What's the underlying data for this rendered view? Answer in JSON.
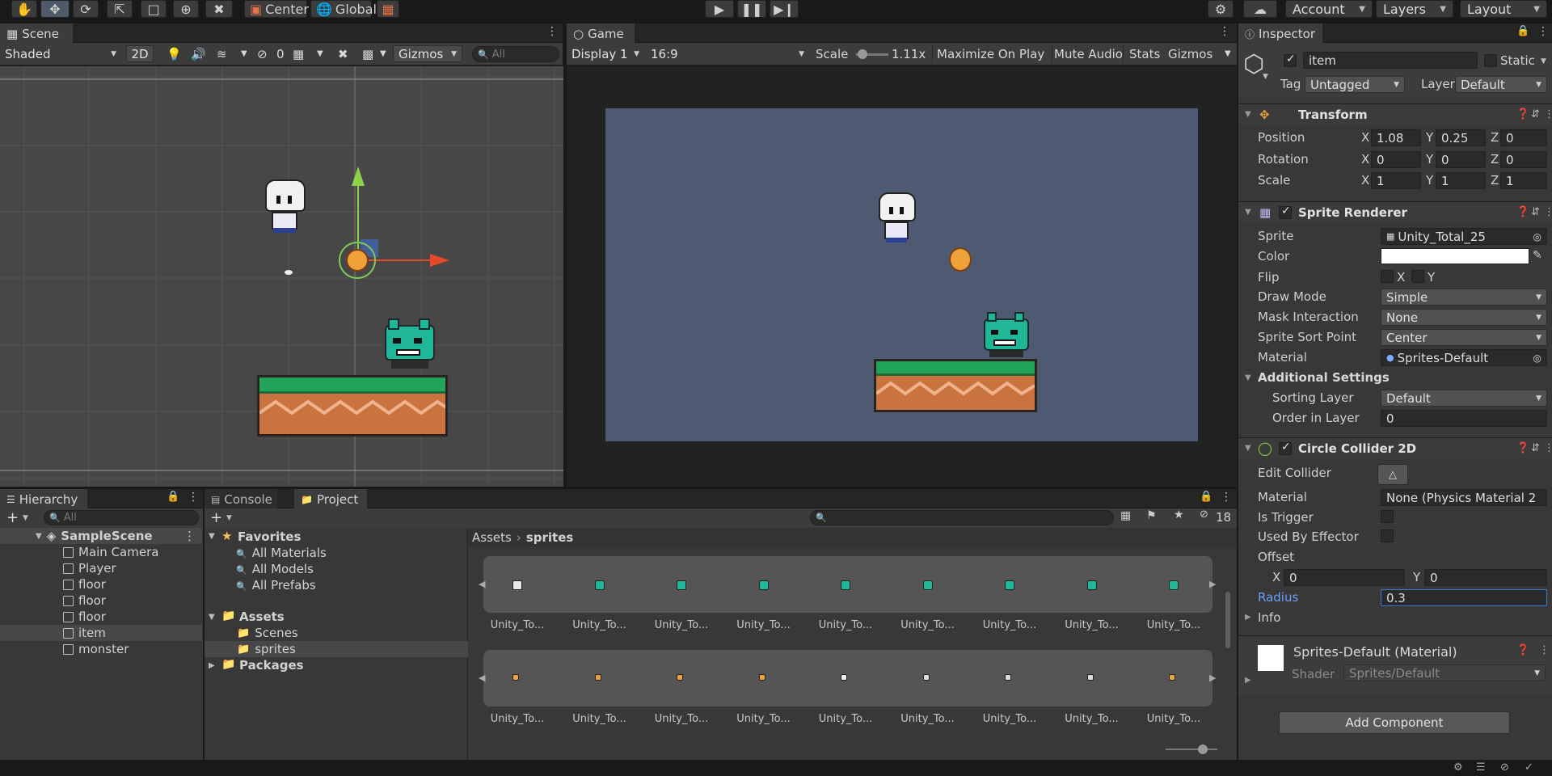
{
  "toolbar": {
    "pivot": "Center",
    "space": "Global",
    "account": "Account",
    "layers": "Layers",
    "layout": "Layout"
  },
  "scene": {
    "tab": "Scene",
    "shading": "Shaded",
    "mode2d": "2D",
    "hidden_count": "0",
    "gizmos": "Gizmos",
    "search_placeholder": "All"
  },
  "game": {
    "tab": "Game",
    "display": "Display 1",
    "aspect": "16:9",
    "scale_label": "Scale",
    "scale_value": "1.11x",
    "maximize": "Maximize On Play",
    "mute": "Mute Audio",
    "stats": "Stats",
    "gizmos": "Gizmos"
  },
  "inspector": {
    "tab": "Inspector",
    "object_name": "item",
    "static_label": "Static",
    "tag_label": "Tag",
    "tag_value": "Untagged",
    "layer_label": "Layer",
    "layer_value": "Default",
    "transform": {
      "title": "Transform",
      "position_label": "Position",
      "rotation_label": "Rotation",
      "scale_label": "Scale",
      "position": {
        "x": "1.08",
        "y": "0.25",
        "z": "0"
      },
      "rotation": {
        "x": "0",
        "y": "0",
        "z": "0"
      },
      "scale": {
        "x": "1",
        "y": "1",
        "z": "1"
      }
    },
    "sprite_renderer": {
      "title": "Sprite Renderer",
      "sprite_label": "Sprite",
      "sprite_value": "Unity_Total_25",
      "color_label": "Color",
      "flip_label": "Flip",
      "flip_x": "X",
      "flip_y": "Y",
      "draw_mode_label": "Draw Mode",
      "draw_mode_value": "Simple",
      "mask_label": "Mask Interaction",
      "mask_value": "None",
      "sort_point_label": "Sprite Sort Point",
      "sort_point_value": "Center",
      "material_label": "Material",
      "material_value": "Sprites-Default",
      "additional_label": "Additional Settings",
      "sorting_layer_label": "Sorting Layer",
      "sorting_layer_value": "Default",
      "order_label": "Order in Layer",
      "order_value": "0"
    },
    "collider": {
      "title": "Circle Collider 2D",
      "edit_label": "Edit Collider",
      "material_label": "Material",
      "material_value": "None (Physics Material 2",
      "trigger_label": "Is Trigger",
      "effector_label": "Used By Effector",
      "offset_label": "Offset",
      "offset_x": "0",
      "offset_y": "0",
      "radius_label": "Radius",
      "radius_value": "0.3",
      "info_label": "Info"
    },
    "material_card": {
      "name": "Sprites-Default (Material)",
      "shader_label": "Shader",
      "shader_value": "Sprites/Default"
    },
    "add_component": "Add Component"
  },
  "hierarchy": {
    "tab": "Hierarchy",
    "search_placeholder": "All",
    "scene_name": "SampleScene",
    "items": [
      "Main Camera",
      "Player",
      "floor",
      "floor",
      "floor",
      "item",
      "monster"
    ]
  },
  "project": {
    "console_tab": "Console",
    "project_tab": "Project",
    "hidden_count": "18",
    "favorites_label": "Favorites",
    "favorites": [
      "All Materials",
      "All Models",
      "All Prefabs"
    ],
    "assets_label": "Assets",
    "asset_folders": [
      "Scenes",
      "sprites"
    ],
    "packages_label": "Packages",
    "breadcrumb_root": "Assets",
    "breadcrumb_current": "sprites",
    "asset_names": [
      "Unity_To...",
      "Unity_To...",
      "Unity_To...",
      "Unity_To...",
      "Unity_To...",
      "Unity_To...",
      "Unity_To...",
      "Unity_To...",
      "Unity_To...",
      "Unity_To...",
      "Unity_To...",
      "Unity_To...",
      "Unity_To...",
      "Unity_To...",
      "Unity_To...",
      "Unity_To...",
      "Unity_To...",
      "Unity_To..."
    ]
  }
}
